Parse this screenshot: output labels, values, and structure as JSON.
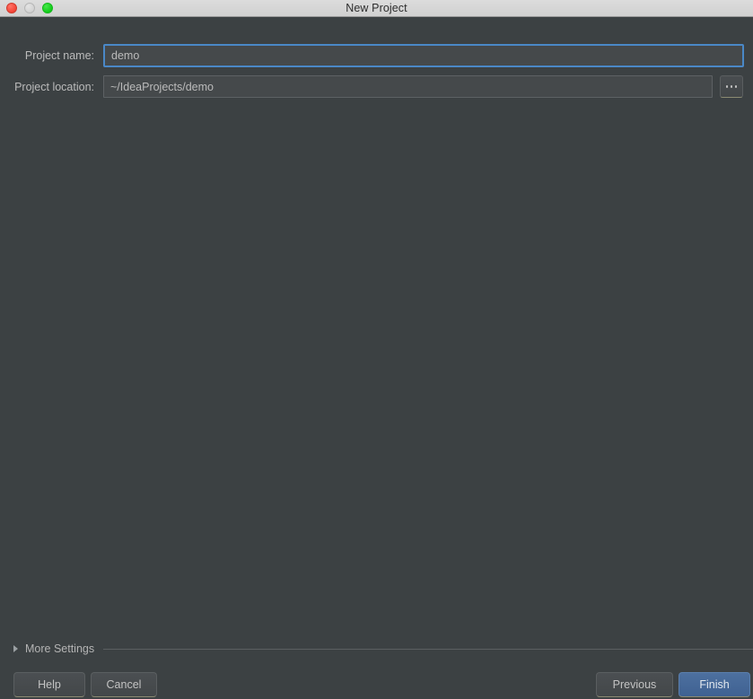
{
  "window": {
    "title": "New Project",
    "traffic_lights": [
      {
        "name": "close",
        "color": "#f44336"
      },
      {
        "name": "minimize",
        "color": "#d2d2d2"
      },
      {
        "name": "maximize",
        "color": "#12cc1a"
      }
    ]
  },
  "form": {
    "project_name": {
      "label": "Project name:",
      "value": "demo",
      "placeholder": "",
      "focused": true
    },
    "project_location": {
      "label": "Project location:",
      "value": "~/IdeaProjects/demo",
      "placeholder": "",
      "focused": false
    },
    "browse_button": {
      "label": "...",
      "icon": "ellipsis-icon"
    }
  },
  "more_settings": {
    "label": "More Settings",
    "expanded": false,
    "arrow_icon": "triangle-right-icon"
  },
  "buttons": {
    "help": "Help",
    "cancel": "Cancel",
    "previous": "Previous",
    "finish": "Finish"
  },
  "colors": {
    "background": "#3c4143",
    "field_background": "#45494b",
    "focus_border": "#4a88c7",
    "default_button": "#4d709f",
    "text": "#bbbbbb",
    "titlebar": "#d4d4d4"
  }
}
